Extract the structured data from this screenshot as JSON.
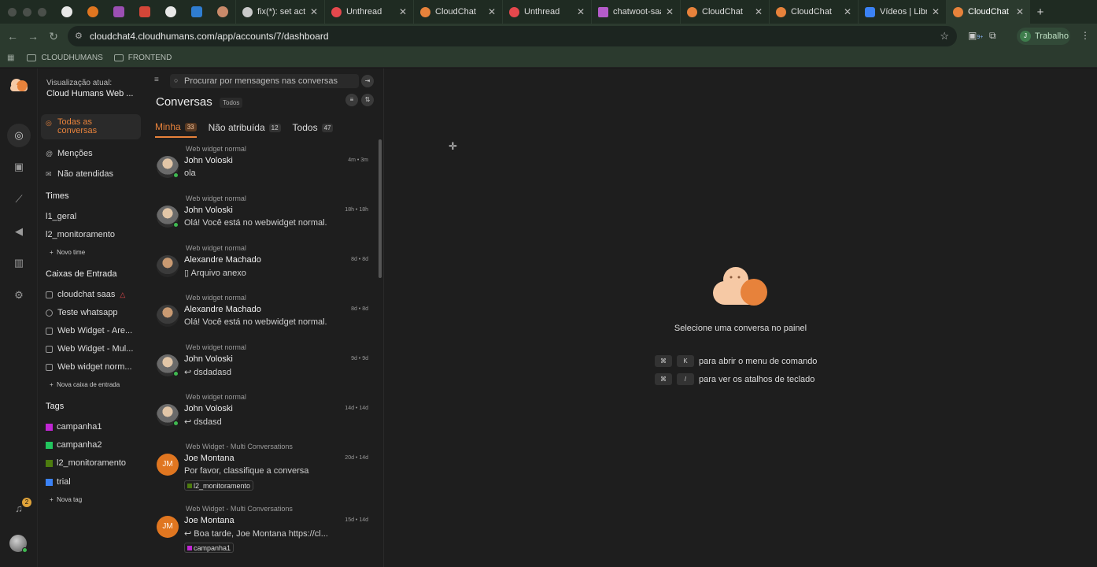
{
  "browser": {
    "tabs": [
      {
        "label": "fix(*): set activ",
        "color": "#c9c9c9"
      },
      {
        "label": "Unthread",
        "color": "#e5484d"
      },
      {
        "label": "CloudChat",
        "color": "#e7823b"
      },
      {
        "label": "Unthread",
        "color": "#e5484d"
      },
      {
        "label": "chatwoot-saas",
        "color": "#b45bc9"
      },
      {
        "label": "CloudChat",
        "color": "#e7823b"
      },
      {
        "label": "CloudChat",
        "color": "#e7823b"
      },
      {
        "label": "Vídeos | Librar",
        "color": "#3b82f6"
      },
      {
        "label": "CloudChat",
        "color": "#e7823b"
      }
    ],
    "url": "cloudchat4.cloudhumans.com/app/accounts/7/dashboard",
    "profile": {
      "initial": "J",
      "label": "Trabalho"
    },
    "ext_badge": "9+",
    "bookmarks": [
      "CLOUDHUMANS",
      "FRONTEND"
    ]
  },
  "sidebar": {
    "view_label": "Visualização atual:",
    "view_value": "Cloud Humans Web ...",
    "nav": [
      {
        "label": "Todas as conversas",
        "icon": "chat-icon"
      },
      {
        "label": "Menções",
        "icon": "at-icon"
      },
      {
        "label": "Não atendidas",
        "icon": "mail-icon"
      }
    ],
    "teams_title": "Times",
    "teams": [
      "l1_geral",
      "l2_monitoramento"
    ],
    "add_team": "Novo time",
    "inbox_title": "Caixas de Entrada",
    "inboxes": [
      "cloudchat saas",
      "Teste whatsapp",
      "Web Widget - Are...",
      "Web Widget - Mul...",
      "Web widget norm..."
    ],
    "add_inbox": "Nova caixa de entrada",
    "tags_title": "Tags",
    "tags": [
      {
        "label": "campanha1",
        "color": "#c026d3"
      },
      {
        "label": "campanha2",
        "color": "#22c55e"
      },
      {
        "label": "l2_monitoramento",
        "color": "#4d7c0f"
      },
      {
        "label": "trial",
        "color": "#3b82f6"
      }
    ],
    "add_tag": "Nova tag",
    "notifications": "2"
  },
  "list": {
    "search_placeholder": "Procurar por mensagens nas conversas",
    "title": "Conversas",
    "status_pill": "Todos",
    "tabs": [
      {
        "label": "Minha",
        "count": "33"
      },
      {
        "label": "Não atribuída",
        "count": "12"
      },
      {
        "label": "Todos",
        "count": "47"
      }
    ],
    "conversations": [
      {
        "inbox": "Web widget normal",
        "name": "John Voloski",
        "time": "4m • 3m",
        "msg": "ola"
      },
      {
        "inbox": "Web widget normal",
        "name": "John Voloski",
        "time": "18h • 18h",
        "msg": "Olá! Você está no webwidget normal."
      },
      {
        "inbox": "Web widget normal",
        "name": "Alexandre Machado",
        "time": "8d • 8d",
        "msg": "Arquivo anexo"
      },
      {
        "inbox": "Web widget normal",
        "name": "Alexandre Machado",
        "time": "8d • 8d",
        "msg": "Olá! Você está no webwidget normal."
      },
      {
        "inbox": "Web widget normal",
        "name": "John Voloski",
        "time": "9d • 9d",
        "msg": "dsdadasd"
      },
      {
        "inbox": "Web widget normal",
        "name": "John Voloski",
        "time": "14d • 14d",
        "msg": "dsdasd"
      },
      {
        "inbox": "Web Widget - Multi Conversations",
        "name": "Joe Montana",
        "initials": "JM",
        "time": "20d • 14d",
        "msg": "Por favor, classifique a conversa",
        "tag": "l2_monitoramento"
      },
      {
        "inbox": "Web Widget - Multi Conversations",
        "name": "Joe Montana",
        "initials": "JM",
        "time": "15d • 14d",
        "msg": "Boa tarde, Joe Montana https://cl...",
        "tag": "campanha1"
      }
    ]
  },
  "main": {
    "empty_text": "Selecione uma conversa no painel",
    "shortcuts": [
      {
        "mod": "⌘",
        "key": "K",
        "text": "para abrir o menu de comando"
      },
      {
        "mod": "⌘",
        "key": "/",
        "text": "para ver os atalhos de teclado"
      }
    ]
  }
}
